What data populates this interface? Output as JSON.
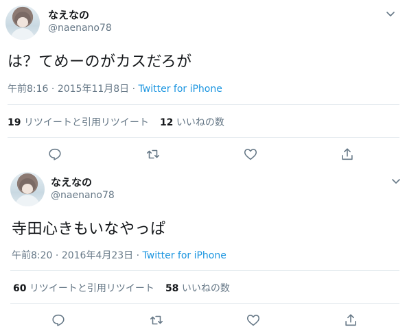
{
  "tweets": [
    {
      "author_name": "なえなの",
      "handle": "@naenano78",
      "text": "は？てめーのがカスだろが",
      "time": "午前8:16",
      "date": "2015年11月8日",
      "source": "Twitter for iPhone",
      "retweets_count": "19",
      "retweets_label": "リツイートと引用リツイート",
      "likes_count": "12",
      "likes_label": "いいねの数"
    },
    {
      "author_name": "なえなの",
      "handle": "@naenano78",
      "text": "寺田心きもいなやっぱ",
      "time": "午前8:20",
      "date": "2016年4月23日",
      "source": "Twitter for iPhone",
      "retweets_count": "60",
      "retweets_label": "リツイートと引用リツイート",
      "likes_count": "58",
      "likes_label": "いいねの数"
    }
  ],
  "icons": {
    "reply": "reply-icon",
    "retweet": "retweet-icon",
    "like": "heart-icon",
    "share": "share-icon",
    "menu": "chevron-down-icon"
  },
  "colors": {
    "text": "#14171a",
    "secondary": "#657786",
    "link": "#1b95e0",
    "divider": "#e6ecf0"
  }
}
